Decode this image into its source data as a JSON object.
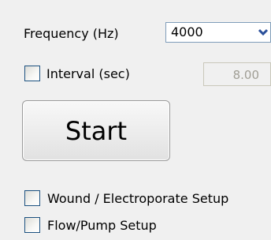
{
  "frequency": {
    "label": "Frequency (Hz)",
    "value": "4000"
  },
  "interval": {
    "label": "Interval (sec)",
    "value": "8.00",
    "checked": false
  },
  "start_button": {
    "label": "Start"
  },
  "options": [
    {
      "label": "Wound / Electroporate Setup",
      "checked": false
    },
    {
      "label": "Flow/Pump Setup",
      "checked": false
    }
  ],
  "colors": {
    "background": "#f0f0f0",
    "checkbox_border": "#1c5180",
    "dropdown_arrow": "#2a4f9a",
    "disabled_text": "#a09e95"
  }
}
